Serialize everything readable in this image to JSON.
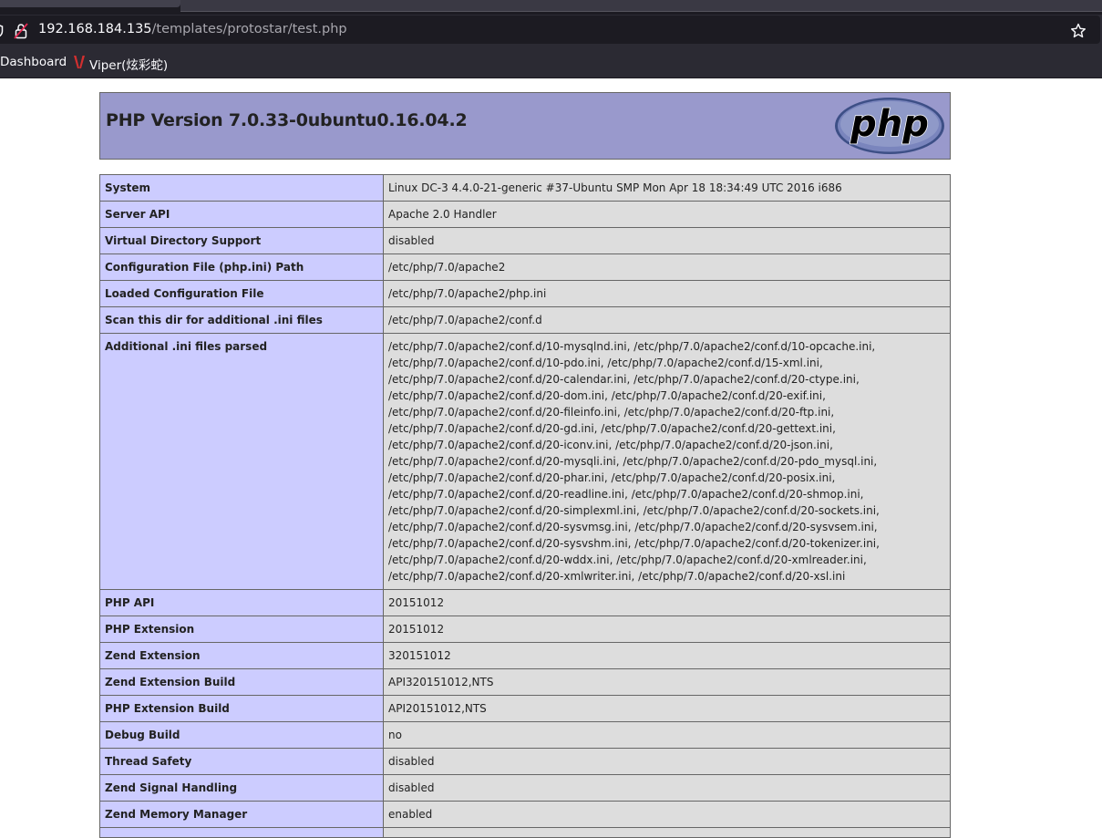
{
  "browser": {
    "url_host": "192.168.184.135",
    "url_path": "/templates/protostar/test.php",
    "bookmarks": [
      {
        "label": "Dashboard"
      },
      {
        "label": "Viper(炫彩蛇)"
      }
    ]
  },
  "phpinfo": {
    "title": "PHP Version 7.0.33-0ubuntu0.16.04.2",
    "logo_text": "php",
    "rows": [
      {
        "key": "System",
        "value": "Linux DC-3 4.4.0-21-generic #37-Ubuntu SMP Mon Apr 18 18:34:49 UTC 2016 i686"
      },
      {
        "key": "Server API",
        "value": "Apache 2.0 Handler"
      },
      {
        "key": "Virtual Directory Support",
        "value": "disabled"
      },
      {
        "key": "Configuration File (php.ini) Path",
        "value": "/etc/php/7.0/apache2"
      },
      {
        "key": "Loaded Configuration File",
        "value": "/etc/php/7.0/apache2/php.ini"
      },
      {
        "key": "Scan this dir for additional .ini files",
        "value": "/etc/php/7.0/apache2/conf.d"
      },
      {
        "key": "Additional .ini files parsed",
        "value": "/etc/php/7.0/apache2/conf.d/10-mysqlnd.ini, /etc/php/7.0/apache2/conf.d/10-opcache.ini, /etc/php/7.0/apache2/conf.d/10-pdo.ini, /etc/php/7.0/apache2/conf.d/15-xml.ini, /etc/php/7.0/apache2/conf.d/20-calendar.ini, /etc/php/7.0/apache2/conf.d/20-ctype.ini, /etc/php/7.0/apache2/conf.d/20-dom.ini, /etc/php/7.0/apache2/conf.d/20-exif.ini, /etc/php/7.0/apache2/conf.d/20-fileinfo.ini, /etc/php/7.0/apache2/conf.d/20-ftp.ini, /etc/php/7.0/apache2/conf.d/20-gd.ini, /etc/php/7.0/apache2/conf.d/20-gettext.ini, /etc/php/7.0/apache2/conf.d/20-iconv.ini, /etc/php/7.0/apache2/conf.d/20-json.ini, /etc/php/7.0/apache2/conf.d/20-mysqli.ini, /etc/php/7.0/apache2/conf.d/20-pdo_mysql.ini, /etc/php/7.0/apache2/conf.d/20-phar.ini, /etc/php/7.0/apache2/conf.d/20-posix.ini, /etc/php/7.0/apache2/conf.d/20-readline.ini, /etc/php/7.0/apache2/conf.d/20-shmop.ini, /etc/php/7.0/apache2/conf.d/20-simplexml.ini, /etc/php/7.0/apache2/conf.d/20-sockets.ini, /etc/php/7.0/apache2/conf.d/20-sysvmsg.ini, /etc/php/7.0/apache2/conf.d/20-sysvsem.ini, /etc/php/7.0/apache2/conf.d/20-sysvshm.ini, /etc/php/7.0/apache2/conf.d/20-tokenizer.ini, /etc/php/7.0/apache2/conf.d/20-wddx.ini, /etc/php/7.0/apache2/conf.d/20-xmlreader.ini, /etc/php/7.0/apache2/conf.d/20-xmlwriter.ini, /etc/php/7.0/apache2/conf.d/20-xsl.ini"
      },
      {
        "key": "PHP API",
        "value": "20151012"
      },
      {
        "key": "PHP Extension",
        "value": "20151012"
      },
      {
        "key": "Zend Extension",
        "value": "320151012"
      },
      {
        "key": "Zend Extension Build",
        "value": "API320151012,NTS"
      },
      {
        "key": "PHP Extension Build",
        "value": "API20151012,NTS"
      },
      {
        "key": "Debug Build",
        "value": "no"
      },
      {
        "key": "Thread Safety",
        "value": "disabled"
      },
      {
        "key": "Zend Signal Handling",
        "value": "disabled"
      },
      {
        "key": "Zend Memory Manager",
        "value": "enabled"
      },
      {
        "key": "",
        "value": ""
      }
    ]
  },
  "colors": {
    "header_bg": "#9999cc",
    "key_bg": "#ccccff",
    "value_bg": "#dddddd"
  },
  "icons": [
    "shield-icon",
    "lock-icon",
    "star-icon",
    "viper-icon",
    "php-logo"
  ]
}
